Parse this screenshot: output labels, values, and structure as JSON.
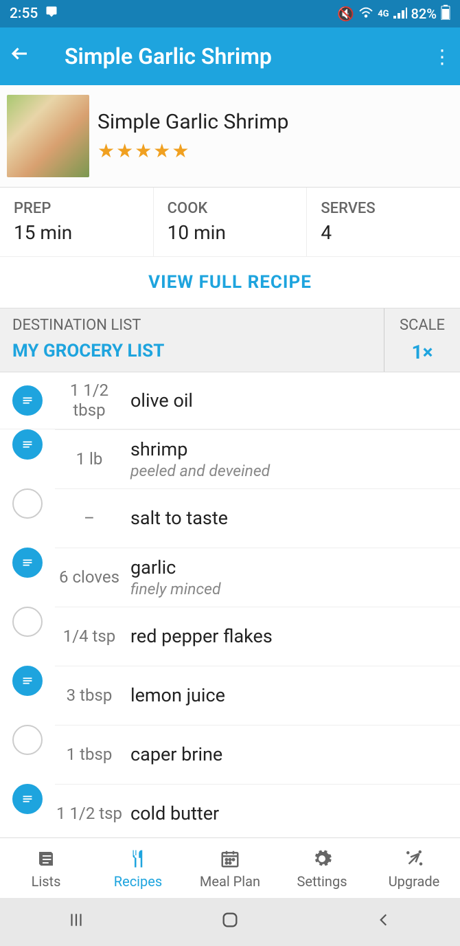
{
  "status": {
    "time": "2:55",
    "battery": "82%",
    "carrier": "4G"
  },
  "appbar": {
    "title": "Simple Garlic Shrimp"
  },
  "recipe": {
    "name": "Simple Garlic Shrimp",
    "rating": 5,
    "prep_label": "PREP",
    "prep_value": "15 min",
    "cook_label": "COOK",
    "cook_value": "10 min",
    "serves_label": "SERVES",
    "serves_value": "4",
    "view_full": "VIEW FULL RECIPE"
  },
  "dest": {
    "label": "DESTINATION LIST",
    "value": "MY GROCERY LIST"
  },
  "scale": {
    "label": "SCALE",
    "value": "1×"
  },
  "ingredients": [
    {
      "checked": true,
      "qty": "1 1/2 tbsp",
      "name": "olive oil",
      "note": ""
    },
    {
      "checked": true,
      "qty": "1 lb",
      "name": "shrimp",
      "note": "peeled and deveined"
    },
    {
      "checked": false,
      "qty": "–",
      "name": "salt to taste",
      "note": ""
    },
    {
      "checked": true,
      "qty": "6 cloves",
      "name": "garlic",
      "note": "finely minced"
    },
    {
      "checked": false,
      "qty": "1/4 tsp",
      "name": "red pepper flakes",
      "note": ""
    },
    {
      "checked": true,
      "qty": "3 tbsp",
      "name": "lemon juice",
      "note": ""
    },
    {
      "checked": false,
      "qty": "1 tbsp",
      "name": "caper brine",
      "note": ""
    },
    {
      "checked": true,
      "qty": "1 1/2 tsp",
      "name": "cold butter",
      "note": ""
    }
  ],
  "nav": {
    "lists": "Lists",
    "recipes": "Recipes",
    "mealplan": "Meal Plan",
    "settings": "Settings",
    "upgrade": "Upgrade"
  }
}
